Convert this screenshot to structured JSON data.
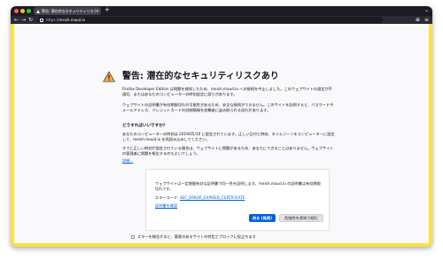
{
  "window": {
    "tab": {
      "title": "警告: 潜在的なセキュリティリスク",
      "close_glyph": "×",
      "new_tab_glyph": "+"
    },
    "traffic_lights": [
      "#ff5f57",
      "#febc2e",
      "#28c840"
    ],
    "url": {
      "prefix": "https://",
      "host": "meish.maud.io"
    }
  },
  "error_page": {
    "title": "警告: 潜在的なセキュリティリスクあり",
    "intro_1": "Firefox Developer Edition は問題を検知したため、meish.maud.io への接続を中止しました。このウェブサイトの設定が不適切、またはあなたのコンピューターの時刻設定に誤りがあります。",
    "intro_2": "ウェブサイトの証明書が有効期限切れの可能性があるため、安全な接続ができません。このサイトを訪問すると、パスワードやメールアドレス、クレジットカードの詳細情報を攻撃者に盗み取られる恐れがあります。",
    "what_heading": "どうすればいいですか?",
    "what_1": "あなたのコンピューターの時刻は 2019/05/10 に設定されています。正しい日付と時刻、タイムゾーンをコンピューターに設定して、meish.maud.io を再読み込みしてください。",
    "what_2": "すでに正しい時刻が設定されている場合は、ウェブサイトに問題があるため、あなたにできることはありません。ウェブサイトの管理者に問題を報告するのもよいでしょう。",
    "learn_more": "詳細...",
    "go_back": "戻る (推奨)",
    "advanced": "詳細..."
  },
  "advanced_panel": {
    "text": "ウェブサイトは一定期間有効な証明書で同一性を証明します。meish.maud.io の証明書は有効期限切れです。",
    "error_code_label": "エラーコード:",
    "error_code": "SEC_ERROR_EXPIRED_CERTIFICATE",
    "view_cert": "証明書を確認",
    "go_back": "戻る (推奨)",
    "accept": "危険性を承知で続行"
  },
  "report": {
    "label": "エラーを報告すると、悪意のあるサイトの特定とブロックに役立ちます"
  },
  "colors": {
    "frame": "#fbe23e",
    "accent": "#0061e0",
    "warning_icon": "#ffa436"
  }
}
